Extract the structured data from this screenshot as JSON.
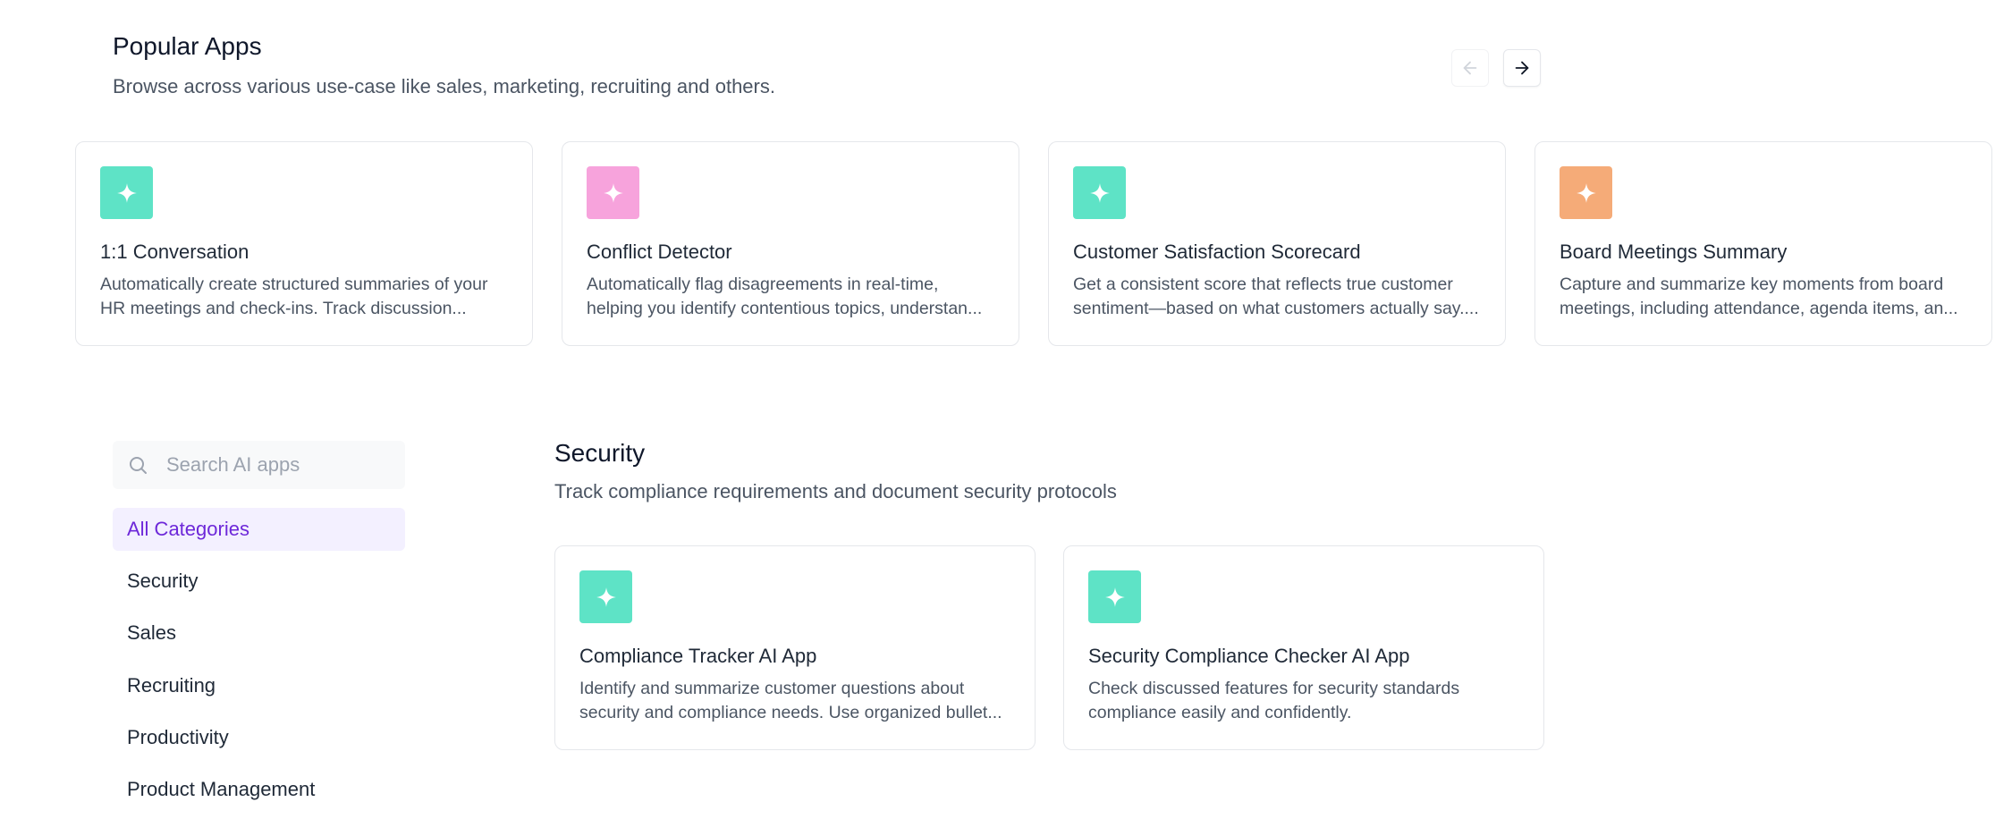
{
  "popular": {
    "title": "Popular Apps",
    "subtitle": "Browse across various use-case like sales, marketing, recruiting and others.",
    "prev_icon": "arrow-left-icon",
    "next_icon": "arrow-right-icon",
    "cards": [
      {
        "title": "1:1 Conversation",
        "description": "Automatically create structured summaries of your HR meetings and check-ins. Track discussion...",
        "icon": "sparkle-icon",
        "icon_color": "#5ee3c6"
      },
      {
        "title": "Conflict Detector",
        "description": "Automatically flag disagreements in real-time, helping you identify contentious topics, understan...",
        "icon": "sparkle-icon",
        "icon_color": "#f7a3dc"
      },
      {
        "title": "Customer Satisfaction Scorecard",
        "description": "Get a consistent score that reflects true customer sentiment—based on what customers actually say....",
        "icon": "sparkle-icon",
        "icon_color": "#5ee3c6"
      },
      {
        "title": "Board Meetings Summary",
        "description": "Capture and summarize key moments from board meetings, including attendance, agenda items, an...",
        "icon": "sparkle-icon",
        "icon_color": "#f5ab78"
      }
    ]
  },
  "sidebar": {
    "search_placeholder": "Search AI apps",
    "search_value": "",
    "categories": [
      {
        "label": "All Categories",
        "active": true
      },
      {
        "label": "Security",
        "active": false
      },
      {
        "label": "Sales",
        "active": false
      },
      {
        "label": "Recruiting",
        "active": false
      },
      {
        "label": "Productivity",
        "active": false
      },
      {
        "label": "Product Management",
        "active": false
      }
    ]
  },
  "section": {
    "title": "Security",
    "subtitle": "Track compliance requirements and document security protocols",
    "cards": [
      {
        "title": "Compliance Tracker AI App",
        "description": "Identify and summarize customer questions about security and compliance needs. Use organized bullet...",
        "icon": "sparkle-icon",
        "icon_color": "#5ee3c6"
      },
      {
        "title": "Security Compliance Checker AI App",
        "description": "Check discussed features for security standards compliance easily and confidently.",
        "icon": "sparkle-icon",
        "icon_color": "#5ee3c6"
      }
    ]
  },
  "colors": {
    "accent": "#6d28d9",
    "active_bg": "#f3f0ff"
  }
}
